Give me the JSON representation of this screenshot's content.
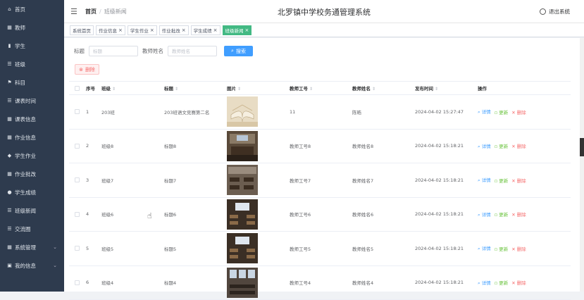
{
  "sidebar": {
    "items": [
      {
        "label": "首页",
        "icon": "home-icon",
        "glyph": "⌂",
        "has_arrow": false
      },
      {
        "label": "教师",
        "icon": "grid-icon",
        "glyph": "▦",
        "has_arrow": false
      },
      {
        "label": "学生",
        "icon": "bar-chart-icon",
        "glyph": "▮",
        "has_arrow": false
      },
      {
        "label": "班级",
        "icon": "list-icon",
        "glyph": "☰",
        "has_arrow": false
      },
      {
        "label": "科目",
        "icon": "flag-icon",
        "glyph": "⚑",
        "has_arrow": false
      },
      {
        "label": "课表时间",
        "icon": "list-icon",
        "glyph": "☰",
        "has_arrow": false
      },
      {
        "label": "课表信息",
        "icon": "grid-icon",
        "glyph": "▦",
        "has_arrow": false
      },
      {
        "label": "作业信息",
        "icon": "grid-icon",
        "glyph": "▦",
        "has_arrow": false
      },
      {
        "label": "学生作业",
        "icon": "thumb-icon",
        "glyph": "◆",
        "has_arrow": false
      },
      {
        "label": "作业批改",
        "icon": "grid-icon",
        "glyph": "▦",
        "has_arrow": false
      },
      {
        "label": "学生成绩",
        "icon": "pin-icon",
        "glyph": "●",
        "has_arrow": false
      },
      {
        "label": "班级新闻",
        "icon": "list-icon",
        "glyph": "☰",
        "has_arrow": false
      },
      {
        "label": "交流圈",
        "icon": "list-icon",
        "glyph": "☰",
        "has_arrow": false
      },
      {
        "label": "系统管理",
        "icon": "grid-icon",
        "glyph": "▦",
        "has_arrow": true
      },
      {
        "label": "我的信息",
        "icon": "info-icon",
        "glyph": "▣",
        "has_arrow": true
      }
    ]
  },
  "header": {
    "breadcrumb_home": "首页",
    "breadcrumb_current": "班级新闻",
    "app_title": "北罗镇中学校务通管理系统",
    "logout_label": "退出系统"
  },
  "tabs": [
    {
      "label": "系统首页",
      "closable": false,
      "active": false
    },
    {
      "label": "作业信息",
      "closable": true,
      "active": false
    },
    {
      "label": "学生作业",
      "closable": true,
      "active": false
    },
    {
      "label": "作业批改",
      "closable": true,
      "active": false
    },
    {
      "label": "学生成绩",
      "closable": true,
      "active": false
    },
    {
      "label": "班级新闻",
      "closable": true,
      "active": true
    }
  ],
  "search": {
    "title_label": "标题",
    "title_placeholder": "标题",
    "teacher_label": "教师姓名",
    "teacher_placeholder": "教师姓名",
    "search_button": "搜索",
    "delete_button": "删除"
  },
  "table": {
    "headers": [
      "序号",
      "班级",
      "标题",
      "图片",
      "教师工号",
      "教师姓名",
      "发布时间",
      "操作"
    ],
    "actions": {
      "detail": "详情",
      "edit": "更新",
      "delete": "删除"
    },
    "rows": [
      {
        "index": "1",
        "class": "203班",
        "title": "203班语文竞赛第二名",
        "image": "open-book",
        "teacher_id": "11",
        "teacher_name": "陈皓",
        "time": "2024-04-02 15:27:47"
      },
      {
        "index": "2",
        "class": "班级8",
        "title": "标题8",
        "image": "meeting-room",
        "teacher_id": "教师工号8",
        "teacher_name": "教师姓名8",
        "time": "2024-04-02 15:18:21"
      },
      {
        "index": "3",
        "class": "班级7",
        "title": "标题7",
        "image": "classroom-desks",
        "teacher_id": "教师工号7",
        "teacher_name": "教师姓名7",
        "time": "2024-04-02 15:18:21"
      },
      {
        "index": "4",
        "class": "班级6",
        "title": "标题6",
        "image": "classroom-screen",
        "teacher_id": "教师工号6",
        "teacher_name": "教师姓名6",
        "time": "2024-04-02 15:18:21"
      },
      {
        "index": "5",
        "class": "班级5",
        "title": "标题5",
        "image": "classroom-screen",
        "teacher_id": "教师工号5",
        "teacher_name": "教师姓名5",
        "time": "2024-04-02 15:18:21"
      },
      {
        "index": "6",
        "class": "班级4",
        "title": "标题4",
        "image": "classroom-window",
        "teacher_id": "教师工号4",
        "teacher_name": "教师姓名4",
        "time": "2024-04-02 15:18:21"
      }
    ]
  },
  "colors": {
    "sidebar_bg": "#2e3b4e",
    "active_tab": "#42b983",
    "primary": "#409eff",
    "danger": "#f56c6c",
    "success": "#67c23a"
  }
}
